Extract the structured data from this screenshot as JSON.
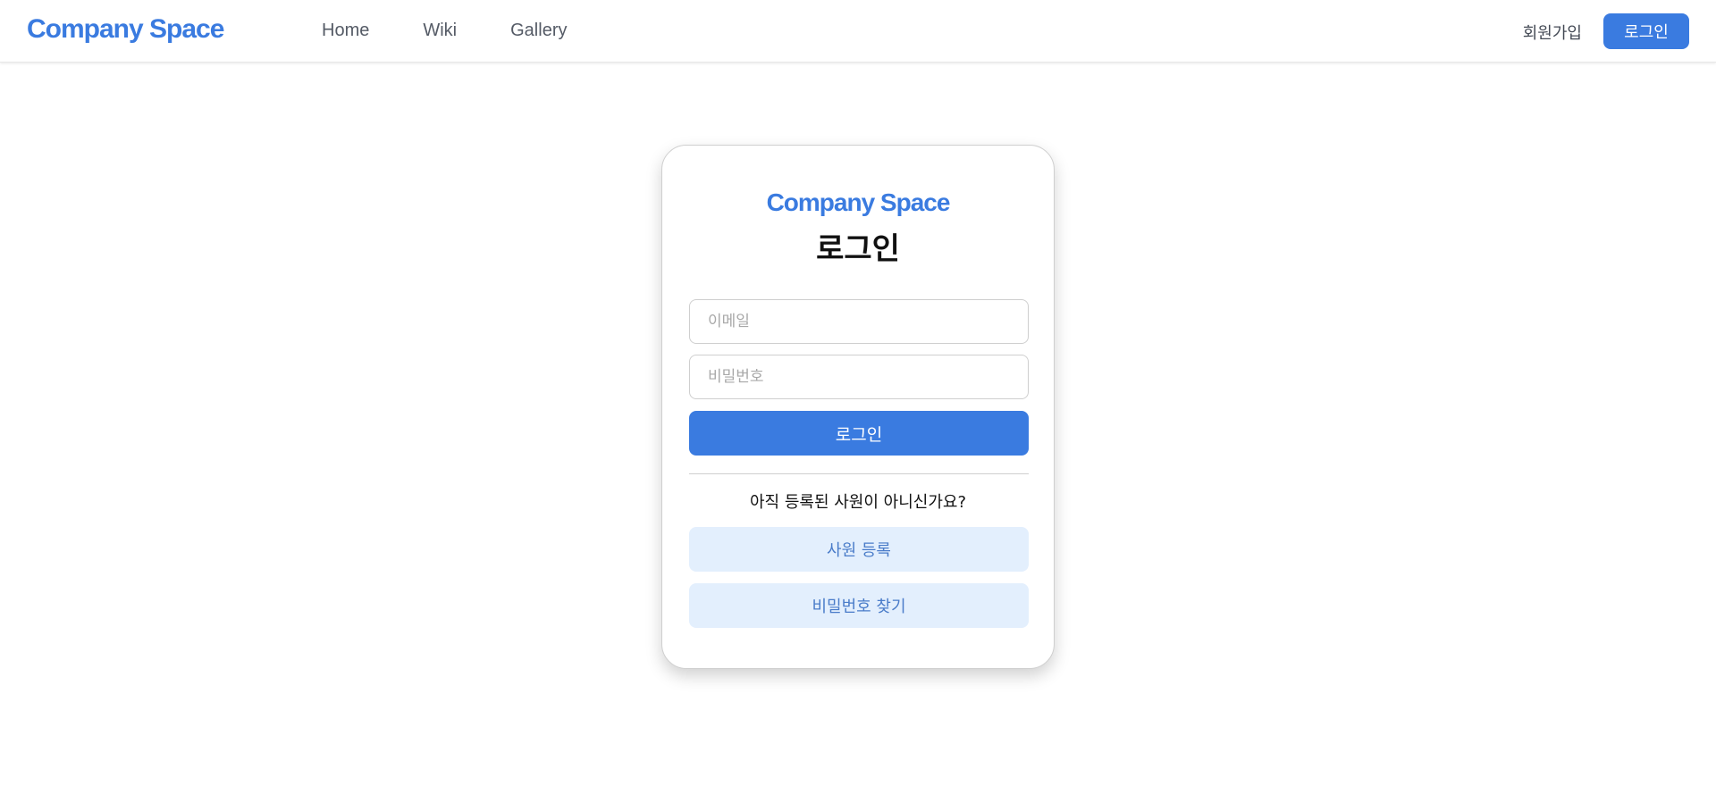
{
  "header": {
    "brand": "Company Space",
    "nav": [
      {
        "label": "Home"
      },
      {
        "label": "Wiki"
      },
      {
        "label": "Gallery"
      }
    ],
    "signup_label": "회원가입",
    "login_label": "로그인"
  },
  "login_card": {
    "brand": "Company Space",
    "title": "로그인",
    "email": {
      "placeholder": "이메일",
      "value": ""
    },
    "password": {
      "placeholder": "비밀번호",
      "value": ""
    },
    "submit_label": "로그인",
    "prompt": "아직 등록된 사원이 아니신가요?",
    "register_label": "사원 등록",
    "find_password_label": "비밀번호 찾기"
  },
  "colors": {
    "accent": "#3a7be0",
    "soft_button_bg": "#e3effd",
    "soft_button_text": "#4a7cc9"
  }
}
